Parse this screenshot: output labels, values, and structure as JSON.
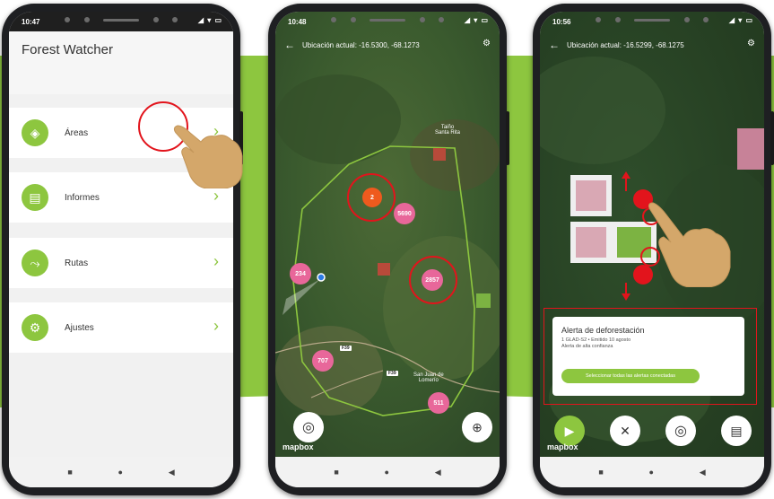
{
  "colors": {
    "brand_green": "#8dc63f",
    "highlight_red": "#e2141c",
    "cluster_pink": "#e8679a",
    "cluster_orange": "#ef5a1e"
  },
  "phone1": {
    "time": "10:47",
    "status_icons": "◢ ▾ ▭",
    "app_title": "Forest Watcher",
    "menu": [
      {
        "label": "Áreas",
        "icon": "areas-icon",
        "glyph": "◈"
      },
      {
        "label": "Informes",
        "icon": "reports-icon",
        "glyph": "▤"
      },
      {
        "label": "Rutas",
        "icon": "routes-icon",
        "glyph": "⤳"
      },
      {
        "label": "Ajustes",
        "icon": "settings-icon",
        "glyph": "⚙"
      }
    ],
    "chevron": "›"
  },
  "phone2": {
    "time": "10:48",
    "status_icons": "◢ ▾ ▭",
    "location": "Ubicación actual: -16.5300, -68.1273",
    "clusters": [
      "2",
      "5690",
      "234",
      "2857",
      "707",
      "511"
    ],
    "place_labels": [
      "Taiño\nSanta Rita",
      "San Juan de\nLomerío"
    ],
    "road_labels": [
      "F39",
      "F39"
    ],
    "mapbox": "mapbox"
  },
  "phone3": {
    "time": "10:56",
    "status_icons": "◢ ▾ ▭",
    "location": "Ubicación actual: -16.5299, -68.1275",
    "alert": {
      "title": "Alerta de deforestación",
      "line1": "1 GLAD-S2 • Emitido 10 agosto",
      "line2": "Alerta de alta confianza",
      "button": "Seleccionar todas las alertas conectadas"
    },
    "mapbox": "mapbox"
  },
  "nav": {
    "square": "■",
    "circle": "●",
    "back": "◀"
  }
}
